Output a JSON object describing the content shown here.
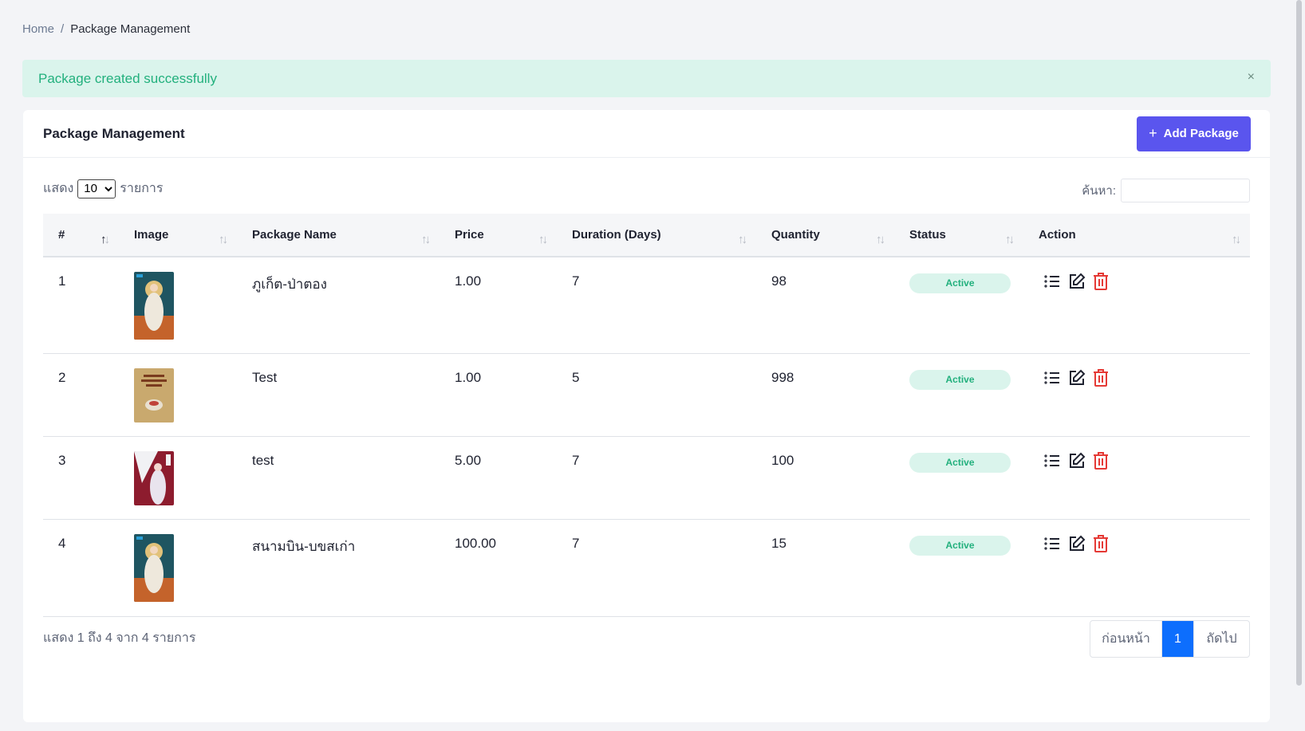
{
  "breadcrumb": {
    "home": "Home",
    "separator": "/",
    "current": "Package Management"
  },
  "alert": {
    "message": "Package created successfully",
    "close": "×"
  },
  "card": {
    "title": "Package Management",
    "add_button": "Add Package",
    "add_icon": "plus-icon"
  },
  "controls": {
    "show_prefix": "แสดง",
    "page_length": "10",
    "page_length_options": [
      "10"
    ],
    "show_suffix": "รายการ",
    "search_label": "ค้นหา:",
    "search_value": ""
  },
  "table": {
    "columns": [
      "#",
      "Image",
      "Package Name",
      "Price",
      "Duration (Days)",
      "Quantity",
      "Status",
      "Action"
    ],
    "rows": [
      {
        "no": "1",
        "image": "poster-goddess-teal",
        "name": "ภูเก็ต-ป่าตอง",
        "price": "1.00",
        "duration": "7",
        "quantity": "98",
        "status": "Active"
      },
      {
        "no": "2",
        "image": "poster-food-beige",
        "name": "Test",
        "price": "1.00",
        "duration": "5",
        "quantity": "998",
        "status": "Active"
      },
      {
        "no": "3",
        "image": "poster-girl-red",
        "name": "test",
        "price": "5.00",
        "duration": "7",
        "quantity": "100",
        "status": "Active"
      },
      {
        "no": "4",
        "image": "poster-goddess-teal",
        "name": "สนามบิน-บขสเก่า",
        "price": "100.00",
        "duration": "7",
        "quantity": "15",
        "status": "Active"
      }
    ]
  },
  "footer": {
    "info": "แสดง 1 ถึง 4 จาก 4 รายการ",
    "prev": "ก่อนหน้า",
    "page": "1",
    "next": "ถัดไป"
  },
  "colors": {
    "primary": "#5a55ee",
    "success": "#22b07d",
    "success_bg": "#daf4ec",
    "danger": "#e53935",
    "page_active": "#0d6efd"
  }
}
